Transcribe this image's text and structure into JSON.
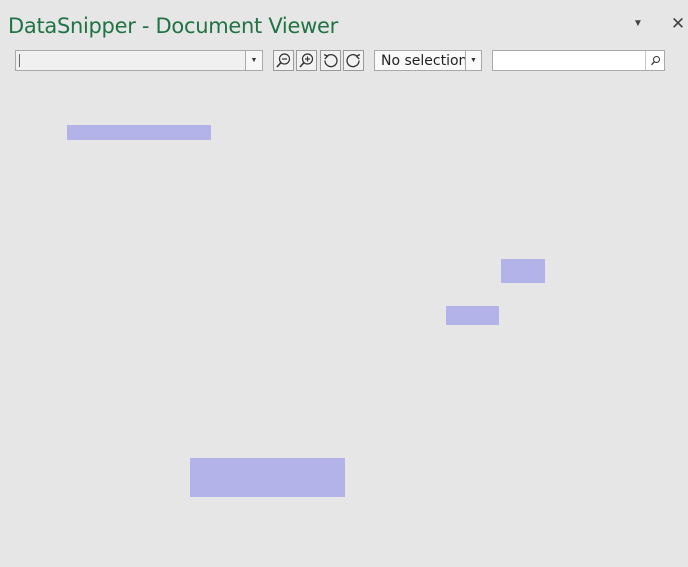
{
  "window": {
    "title": "DataSnipper - Document Viewer",
    "options_icon": "dropdown-arrow-icon",
    "close_icon": "close-icon",
    "close_glyph": "✕",
    "options_glyph": "▼"
  },
  "toolbar": {
    "document_select": {
      "value": "",
      "dropdown_glyph": "▼"
    },
    "buttons": [
      {
        "name": "zoom-out",
        "icon": "zoom-out-icon"
      },
      {
        "name": "zoom-in",
        "icon": "zoom-in-icon"
      },
      {
        "name": "rotate-left",
        "icon": "rotate-left-icon"
      },
      {
        "name": "rotate-right",
        "icon": "rotate-right-icon"
      }
    ],
    "selection_combo": {
      "value": "No selection",
      "dropdown_glyph": "▼"
    },
    "search": {
      "value": "",
      "placeholder": "",
      "icon": "search-icon"
    }
  },
  "colors": {
    "title": "#217346",
    "background": "#e6e6e6",
    "highlight": "#b3b3ea"
  },
  "viewer": {
    "highlights": [
      {
        "name": "highlight-1"
      },
      {
        "name": "highlight-2"
      },
      {
        "name": "highlight-3"
      },
      {
        "name": "highlight-4"
      }
    ]
  }
}
